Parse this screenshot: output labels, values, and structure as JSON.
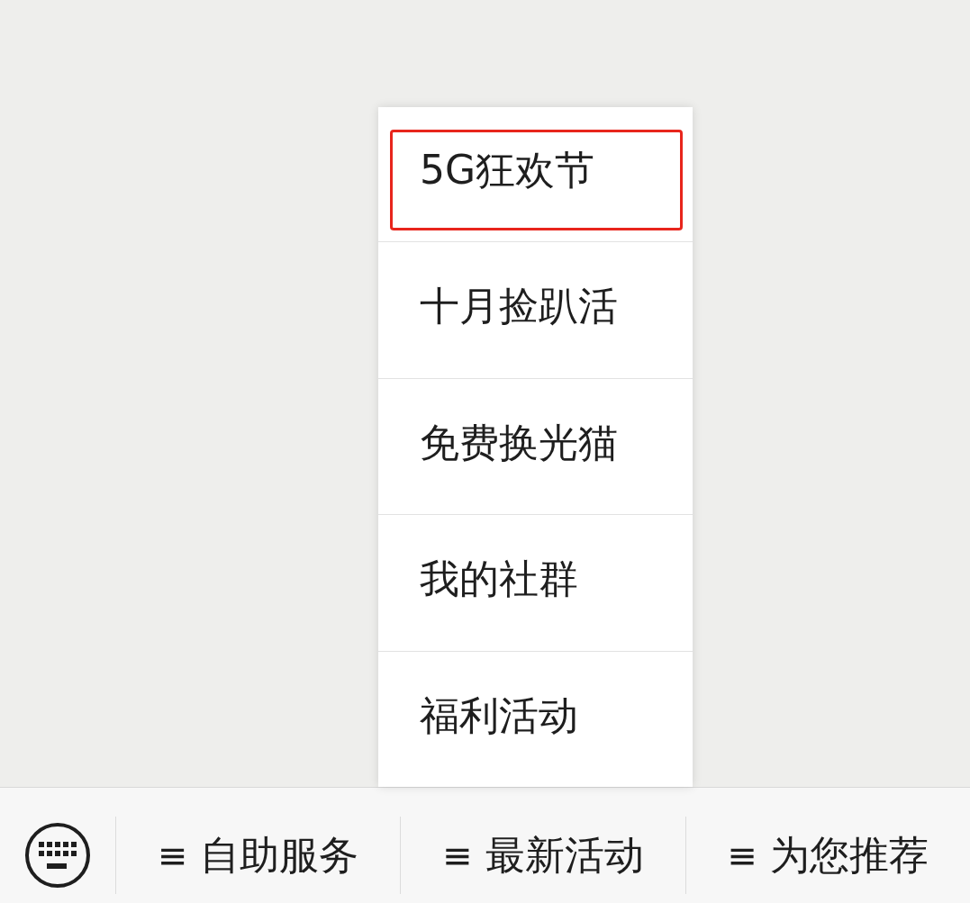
{
  "popup_menu": {
    "items": [
      {
        "label": "5G狂欢节",
        "highlighted": true
      },
      {
        "label": "十月捡趴活",
        "highlighted": false
      },
      {
        "label": "免费换光猫",
        "highlighted": false
      },
      {
        "label": "我的社群",
        "highlighted": false
      },
      {
        "label": "福利活动",
        "highlighted": false
      }
    ]
  },
  "bottom_bar": {
    "menus": [
      {
        "icon": "≡",
        "label": "自助服务"
      },
      {
        "icon": "≡",
        "label": "最新活动"
      },
      {
        "icon": "≡",
        "label": "为您推荐"
      }
    ]
  }
}
